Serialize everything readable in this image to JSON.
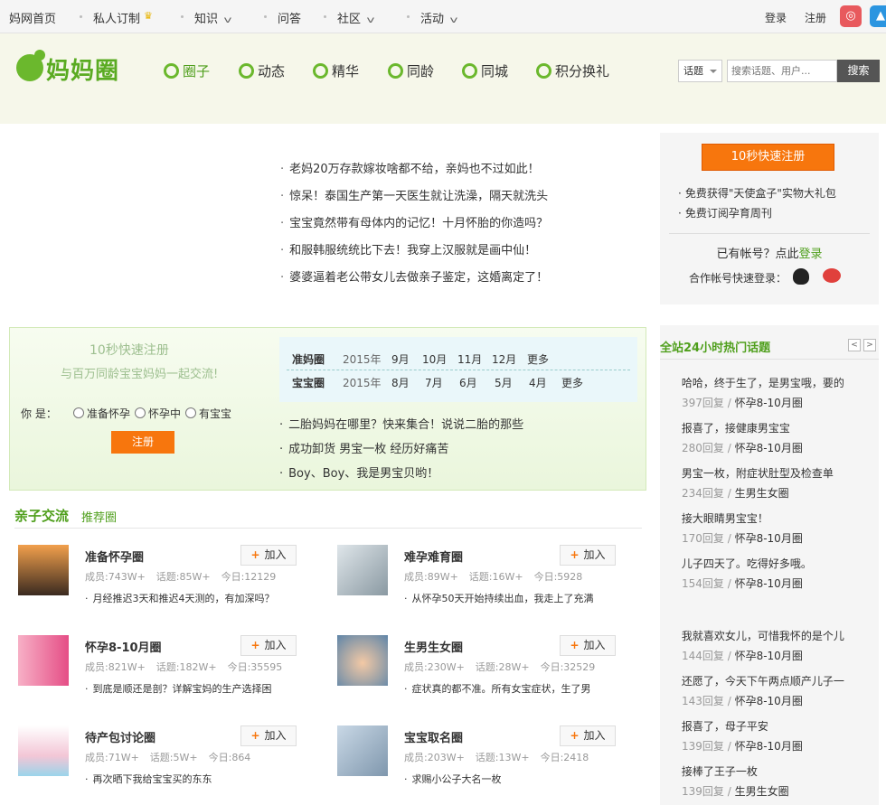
{
  "topbar": {
    "links": [
      "妈网首页",
      "私人订制",
      "知识",
      "问答",
      "社区",
      "活动"
    ],
    "login": "登录",
    "register": "注册"
  },
  "brand": {
    "name": "妈妈圈"
  },
  "nav": [
    "圈子",
    "动态",
    "精华",
    "同龄",
    "同城",
    "积分换礼"
  ],
  "search": {
    "type": "话题",
    "placeholder": "搜索话题、用户...",
    "button": "搜索"
  },
  "news": [
    "老妈20万存款嫁妆啥都不给，亲妈也不过如此！",
    "惊呆！泰国生产第一天医生就让洗澡，隔天就洗头",
    "宝宝竟然带有母体内的记忆！十月怀胎的你造吗？",
    "和服韩服统统比下去！我穿上汉服就是画中仙！",
    "婆婆逼着老公带女儿去做亲子鉴定，这婚离定了！"
  ],
  "register_box": {
    "button": "10秒快速注册",
    "benefits": [
      "免费获得\"天使盒子\"实物大礼包",
      "免费订阅孕育周刊"
    ],
    "have_account": "已有帐号？点此",
    "login_link": "登录",
    "coop": "合作帐号快速登录："
  },
  "quickreg": {
    "title": "10秒快速注册",
    "subtitle": "与百万同龄宝宝妈妈一起交流!",
    "you_are": "你 是：",
    "options": [
      "准备怀孕",
      "怀孕中",
      "有宝宝"
    ],
    "button": "注册"
  },
  "months": {
    "row1": {
      "label": "准妈圈",
      "year": "2015年",
      "items": [
        "9月",
        "10月",
        "11月",
        "12月",
        "更多"
      ]
    },
    "row2": {
      "label": "宝宝圈",
      "year": "2015年",
      "items": [
        "8月",
        "7月",
        "6月",
        "5月",
        "4月",
        "更多"
      ]
    }
  },
  "green_news": [
    "二胎妈妈在哪里？快来集合！说说二胎的那些",
    "成功卸货 男宝一枚 经历好痛苦",
    "Boy、Boy、我是男宝贝哟！"
  ],
  "section": {
    "title": "亲子交流",
    "sub": "推荐圈"
  },
  "join_label": "加入",
  "groups": [
    {
      "name": "准备怀孕圈",
      "members": "成员:743W+",
      "topics": "话题:85W+",
      "today": "今日:12129",
      "latest": "月经推迟3天和推迟4天测的，有加深吗？"
    },
    {
      "name": "难孕难育圈",
      "members": "成员:89W+",
      "topics": "话题:16W+",
      "today": "今日:5928",
      "latest": "从怀孕50天开始持续出血，我走上了充满"
    },
    {
      "name": "怀孕8-10月圈",
      "members": "成员:821W+",
      "topics": "话题:182W+",
      "today": "今日:35595",
      "latest": "到底是顺还是剖？详解宝妈的生产选择困"
    },
    {
      "name": "生男生女圈",
      "members": "成员:230W+",
      "topics": "话题:28W+",
      "today": "今日:32529",
      "latest": "症状真的都不准。所有女宝症状，生了男"
    },
    {
      "name": "待产包讨论圈",
      "members": "成员:71W+",
      "topics": "话题:5W+",
      "today": "今日:864",
      "latest": "再次晒下我给宝宝买的东东"
    },
    {
      "name": "宝宝取名圈",
      "members": "成员:203W+",
      "topics": "话题:13W+",
      "today": "今日:2418",
      "latest": "求赐小公子大名一枚"
    }
  ],
  "hot": {
    "title": "全站24小时热门话题",
    "items": [
      {
        "q": "哈哈，终于生了，是男宝哦，要的",
        "r": "397回复",
        "g": "怀孕8-10月圈"
      },
      {
        "q": "报喜了，接健康男宝宝",
        "r": "280回复",
        "g": "怀孕8-10月圈"
      },
      {
        "q": "男宝一枚，附症状肚型及检查单",
        "r": "234回复",
        "g": "生男生女圈"
      },
      {
        "q": "接大眼睛男宝宝！",
        "r": "170回复",
        "g": "怀孕8-10月圈"
      },
      {
        "q": "儿子四天了。吃得好多哦。",
        "r": "154回复",
        "g": "怀孕8-10月圈"
      },
      {
        "q": "我就喜欢女儿，可惜我怀的是个儿",
        "r": "144回复",
        "g": "怀孕8-10月圈"
      },
      {
        "q": "还愿了，今天下午两点顺产儿子一",
        "r": "143回复",
        "g": "怀孕8-10月圈"
      },
      {
        "q": "报喜了，母子平安",
        "r": "139回复",
        "g": "怀孕8-10月圈"
      },
      {
        "q": "接棒了王子一枚",
        "r": "139回复",
        "g": "生男生女圈"
      }
    ]
  }
}
